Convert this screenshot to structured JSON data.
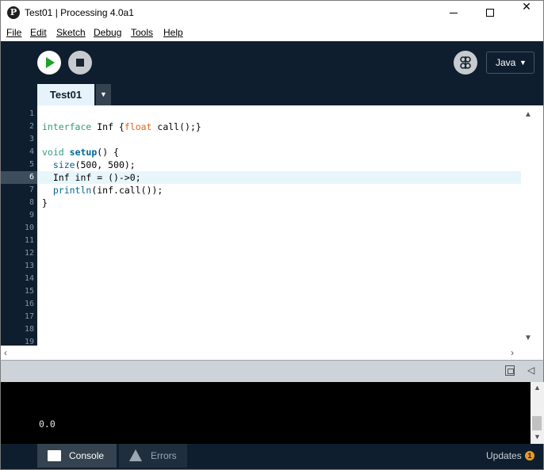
{
  "window": {
    "title": "Test01 | Processing 4.0a1",
    "app_icon_glyph": "P"
  },
  "menu": [
    {
      "label": "File"
    },
    {
      "label": "Edit"
    },
    {
      "label": "Sketch"
    },
    {
      "label": "Debug"
    },
    {
      "label": "Tools"
    },
    {
      "label": "Help"
    }
  ],
  "toolbar": {
    "mode_label": "Java",
    "mode_arrow": "▼"
  },
  "tabs": {
    "active_label": "Test01",
    "menu_arrow": "▼"
  },
  "editor": {
    "current_line": 6,
    "line_numbers": [
      "1",
      "2",
      "3",
      "4",
      "5",
      "6",
      "7",
      "8",
      "9",
      "10",
      "11",
      "12",
      "13",
      "14",
      "15",
      "16",
      "17",
      "18",
      "19"
    ],
    "lines": [
      "",
      "interface Inf {float call();}",
      "",
      "void setup() {",
      "  size(500, 500);",
      "  Inf inf = ()->0;",
      "  println(inf.call());",
      "}",
      "",
      "",
      "",
      "",
      "",
      "",
      "",
      "",
      "",
      "",
      ""
    ]
  },
  "console": {
    "output": "0.0"
  },
  "footer": {
    "console_tab": "Console",
    "errors_tab": "Errors",
    "updates_label": "Updates",
    "updates_count": "1"
  },
  "colors": {
    "toolbar_bg": "#0f1e2e",
    "run_green": "#1ba32d",
    "keyword": "#33997e",
    "type_keyword": "#e2661a",
    "function": "#006699",
    "badge": "#e79a27"
  }
}
